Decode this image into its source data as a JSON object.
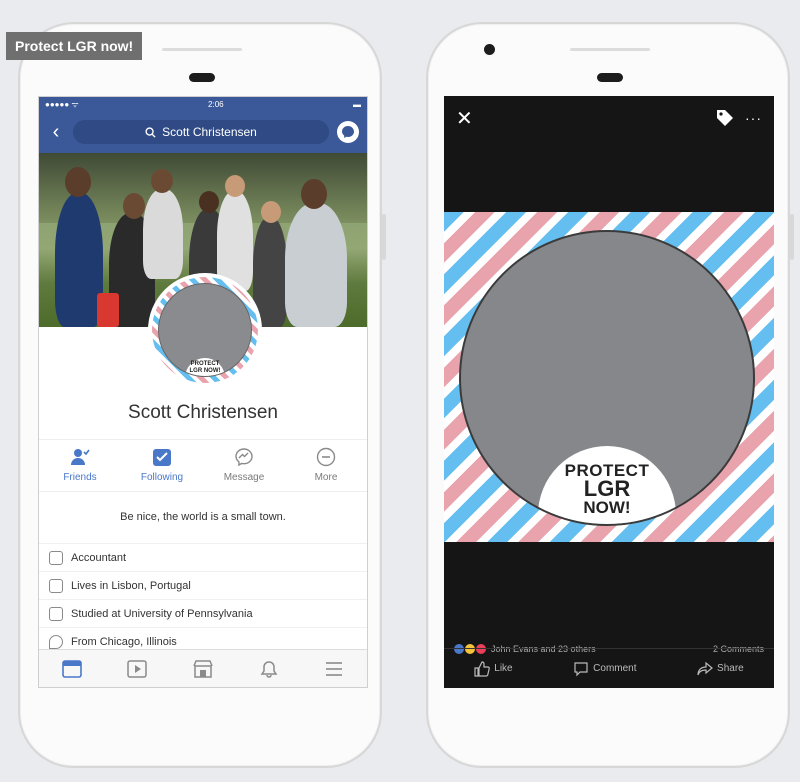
{
  "overlay_tag": "Protect LGR now!",
  "left_phone": {
    "status": {
      "carrier": "●●●●● ᯤ",
      "time": "2:06",
      "battery": "▬"
    },
    "search": {
      "text": "Scott Christensen"
    },
    "avatar_badge": "PROTECT LGR NOW!",
    "profile_name": "Scott Christensen",
    "actions": [
      {
        "label": "Friends",
        "icon": "friends-icon"
      },
      {
        "label": "Following",
        "icon": "following-icon"
      },
      {
        "label": "Message",
        "icon": "messenger-icon"
      },
      {
        "label": "More",
        "icon": "more-icon"
      }
    ],
    "bio": "Be nice, the world is a small town.",
    "info": [
      {
        "text": "Accountant",
        "icon": "briefcase-icon"
      },
      {
        "text": "Lives in Lisbon, Portugal",
        "icon": "home-icon"
      },
      {
        "text": "Studied at University of Pennsylvania",
        "icon": "education-icon"
      },
      {
        "text": "From Chicago, Illinois",
        "icon": "location-icon"
      }
    ],
    "tabs": [
      "news-feed-icon",
      "video-icon",
      "marketplace-icon",
      "notifications-icon",
      "menu-icon"
    ]
  },
  "right_phone": {
    "badge": {
      "line1": "PROTECT",
      "line2": "LGR",
      "line3": "NOW!"
    },
    "reactions_text": "John Evans and 23 others",
    "comments": "2 Comments",
    "photo_actions": {
      "like": "Like",
      "comment": "Comment",
      "share": "Share"
    },
    "colors": {
      "stripe_blue": "#64bff0",
      "stripe_pink": "#e9a3ad",
      "facebook_blue": "#3b5998"
    }
  }
}
